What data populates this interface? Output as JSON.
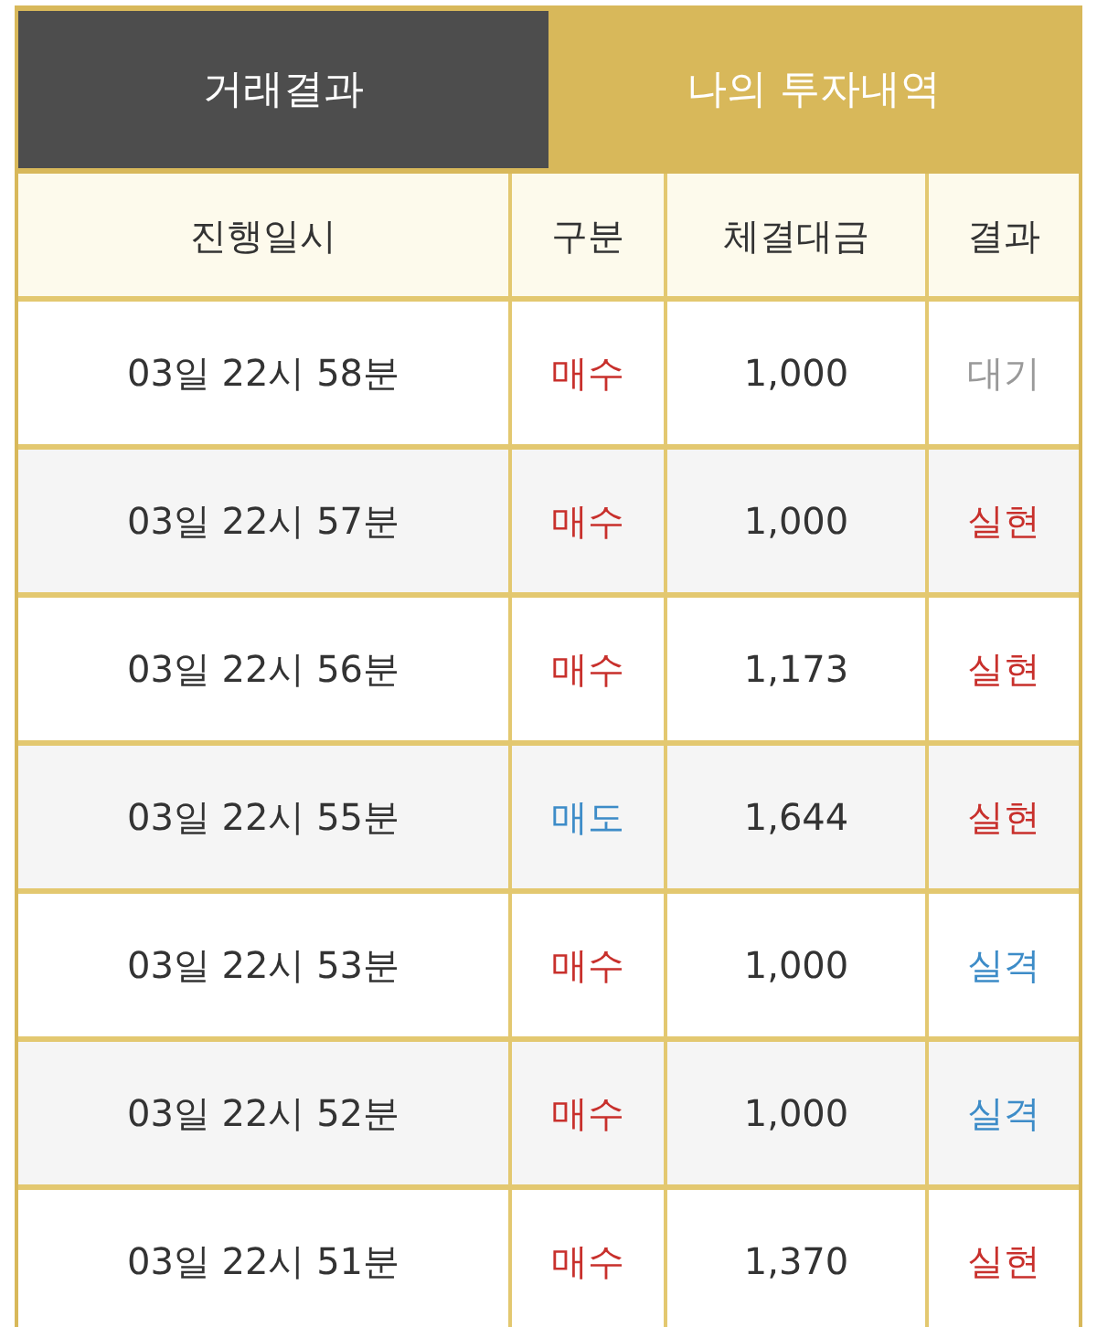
{
  "tabs": [
    {
      "label": "거래결과",
      "selected": true
    },
    {
      "label": "나의 투자내역",
      "selected": false
    }
  ],
  "table": {
    "columns": [
      "진행일시",
      "구분",
      "체결대금",
      "결과"
    ],
    "rows": [
      {
        "time": "03일 22시 58분",
        "side": {
          "label": "매수",
          "kind": "buy"
        },
        "amount": "1,000",
        "result": {
          "label": "대기",
          "kind": "pending"
        }
      },
      {
        "time": "03일 22시 57분",
        "side": {
          "label": "매수",
          "kind": "buy"
        },
        "amount": "1,000",
        "result": {
          "label": "실현",
          "kind": "win"
        }
      },
      {
        "time": "03일 22시 56분",
        "side": {
          "label": "매수",
          "kind": "buy"
        },
        "amount": "1,173",
        "result": {
          "label": "실현",
          "kind": "win"
        }
      },
      {
        "time": "03일 22시 55분",
        "side": {
          "label": "매도",
          "kind": "sell"
        },
        "amount": "1,644",
        "result": {
          "label": "실현",
          "kind": "win"
        }
      },
      {
        "time": "03일 22시 53분",
        "side": {
          "label": "매수",
          "kind": "buy"
        },
        "amount": "1,000",
        "result": {
          "label": "실격",
          "kind": "loss"
        }
      },
      {
        "time": "03일 22시 52분",
        "side": {
          "label": "매수",
          "kind": "buy"
        },
        "amount": "1,000",
        "result": {
          "label": "실격",
          "kind": "loss"
        }
      },
      {
        "time": "03일 22시 51분",
        "side": {
          "label": "매수",
          "kind": "buy"
        },
        "amount": "1,370",
        "result": {
          "label": "실현",
          "kind": "win"
        }
      }
    ]
  }
}
